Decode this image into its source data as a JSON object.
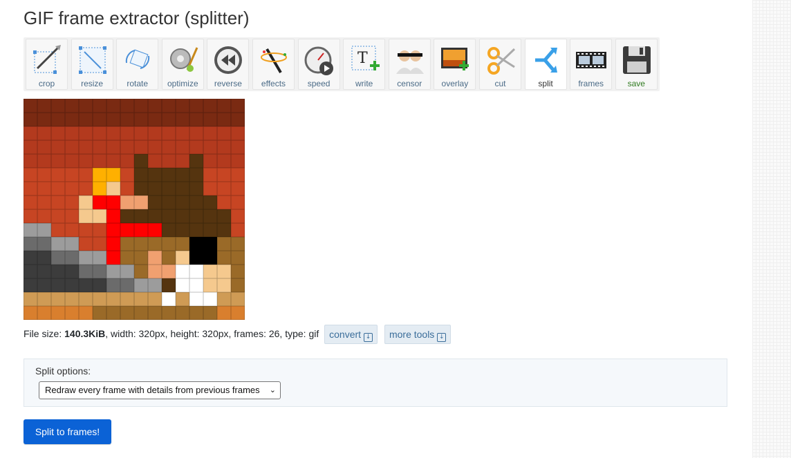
{
  "page_title": "GIF frame extractor (splitter)",
  "toolbar": {
    "tools": [
      {
        "id": "crop",
        "label": "crop",
        "icon": "crop-icon"
      },
      {
        "id": "resize",
        "label": "resize",
        "icon": "resize-icon"
      },
      {
        "id": "rotate",
        "label": "rotate",
        "icon": "rotate-icon"
      },
      {
        "id": "optimize",
        "label": "optimize",
        "icon": "optimize-icon"
      },
      {
        "id": "reverse",
        "label": "reverse",
        "icon": "reverse-icon"
      },
      {
        "id": "effects",
        "label": "effects",
        "icon": "effects-icon"
      },
      {
        "id": "speed",
        "label": "speed",
        "icon": "speed-icon"
      },
      {
        "id": "write",
        "label": "write",
        "icon": "write-icon"
      },
      {
        "id": "censor",
        "label": "censor",
        "icon": "censor-icon"
      },
      {
        "id": "overlay",
        "label": "overlay",
        "icon": "overlay-icon"
      },
      {
        "id": "cut",
        "label": "cut",
        "icon": "cut-icon"
      },
      {
        "id": "split",
        "label": "split",
        "icon": "split-icon",
        "active": true
      },
      {
        "id": "frames",
        "label": "frames",
        "icon": "frames-icon"
      },
      {
        "id": "save",
        "label": "save",
        "icon": "save-icon"
      }
    ]
  },
  "preview": {
    "palette": {
      "A": "#7a2a12",
      "B": "#b33a1e",
      "C": "#c74523",
      "D": "#55340f",
      "E": "#ffb000",
      "F": "#f5c98e",
      "R": "#ff0000",
      "S": "#f0a070",
      "G": "#9c9c9c",
      "H": "#6b6b6b",
      "K": "#3c3c3c",
      "M": "#9a6a28",
      "N": "#000000",
      "W": "#ffffff",
      "T": "#cf9b55",
      "U": "#d97f2e"
    },
    "rows": [
      "AAAAAAAAAAAAAAAA",
      "AAAAAAAAAAAAAAAA",
      "BBBBBBBBBBBBBBBB",
      "BBBBBBBBBBBBBBBB",
      "BBBBBBBBDBBBDBBB",
      "CCCCCEECDDDDDCCC",
      "CCCCCEFCDDDDDCCC",
      "CCCCFRRSSDDDDDCC",
      "CCCCFFRDDDDDDDDC",
      "GGCCCCRRRRDDDDDC",
      "HHGGCCRMMMMMNNMM",
      "KKHHGGRMMSMFNNMM",
      "KKKKHHGGMSSWWFFM",
      "KKKKKKHHGGDWWFFM",
      "TTTTTTTTTTWTWWTT",
      "UUUUUMMMMMMMMMUU"
    ]
  },
  "file_info": {
    "size_label": "File size: ",
    "size_value": "140.3KiB",
    "rest": ", width: 320px, height: 320px, frames: 26, type: gif",
    "convert_label": "convert",
    "more_tools_label": "more tools"
  },
  "split_options": {
    "title": "Split options:",
    "selected": "Redraw every frame with details from previous frames"
  },
  "submit_label": "Split to frames!"
}
